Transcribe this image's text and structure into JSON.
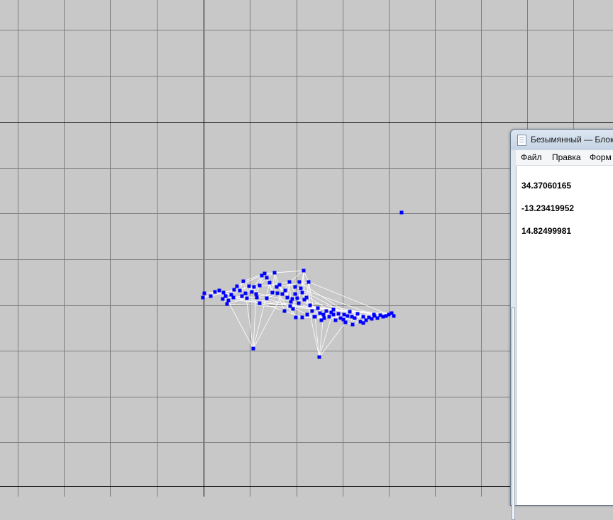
{
  "viewport": {
    "background": "#c8c8c8",
    "grid_color": "#7e7e7e",
    "axis_color": "#000000",
    "edge_color": "#ffffff",
    "vertex_color": "#0000ff"
  },
  "notepad": {
    "title": "Безымянный — Блок",
    "icon": "notepad-icon",
    "menu": [
      "Файл",
      "Правка",
      "Форм"
    ],
    "lines": [
      "34.37060165",
      "-13.23419952",
      "14.82499981"
    ]
  }
}
